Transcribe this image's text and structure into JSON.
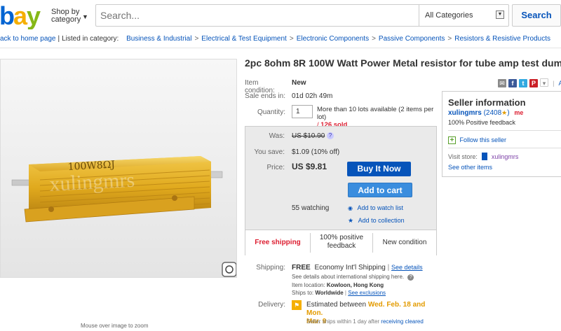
{
  "header": {
    "logo_text": "bay",
    "shop_by_line1": "Shop by",
    "shop_by_line2": "category",
    "search_placeholder": "Search...",
    "category_select": "All Categories",
    "search_button": "Search"
  },
  "breadcrumb": {
    "back": "ack to home page",
    "listed_in": "Listed in category:",
    "items": [
      "Business & Industrial",
      "Electrical & Test Equipment",
      "Electronic Components",
      "Passive Components",
      "Resistors & Resistive Products"
    ]
  },
  "image": {
    "caption": "Mouse over image to zoom",
    "printed_label": "100W8ΩJ",
    "watermark": "xulingmrs"
  },
  "listing": {
    "title": "2pc 8ohm 8R 100W Watt Power Metal resistor for tube amp test dummy",
    "condition_label": "Item condition:",
    "condition_value": "New",
    "share_cut": "Ad",
    "ends_label": "Sale ends in:",
    "ends_value": "01d 02h 49m",
    "qty_label": "Quantity:",
    "qty_value": "1",
    "lots_available": "More than 10 lots available (2 items per lot)",
    "sold_prefix": "/ ",
    "sold": "126 sold"
  },
  "price": {
    "was_label": "Was:",
    "was_value": "US $10.90",
    "save_label": "You save:",
    "save_value": "$1.09 (10% off)",
    "price_label": "Price:",
    "price_value": "US $9.81",
    "buy_button": "Buy It Now",
    "cart_button": "Add to cart",
    "watching": "55 watching",
    "watch_link": "Add to watch list",
    "collection_link": "Add to collection",
    "badges": [
      "Free shipping",
      "100% positive feedback",
      "New condition"
    ]
  },
  "seller": {
    "heading": "Seller information",
    "name": "xulingmrs",
    "score": "(2408",
    "score_close": ")",
    "me_badge": "me",
    "positive": "100% Positive feedback",
    "follow": "Follow this seller",
    "visit_store_label": "Visit store:",
    "store_name": "xulingmrs",
    "other_items": "See other items"
  },
  "shipping": {
    "label": "Shipping:",
    "free": "FREE",
    "method": "Economy Int'l Shipping",
    "details_sep": "|",
    "details_link": "See details",
    "intl_note": "See details about international shipping here.",
    "location_label": "Item location:",
    "location": "Kowloon, Hong Kong",
    "ships_to_label": "Ships to:",
    "ships_to": "Worldwide",
    "exclusions": "See exclusions"
  },
  "delivery": {
    "label": "Delivery:",
    "estimated": "Estimated between",
    "dates_line1": "Wed. Feb. 18 and Mon.",
    "dates_line2": "Mar. 9",
    "note": "Seller ships within 1 day after",
    "note_link": "receiving cleared"
  },
  "colors": {
    "link": "#0654ba",
    "buy_button": "#0654ba",
    "cart_button": "#3a8dde",
    "free_shipping": "#dd1e31",
    "delivery_dates": "#e39b00",
    "logo_blue": "#0064d2",
    "logo_yellow": "#f5af02",
    "logo_green": "#86b817"
  }
}
